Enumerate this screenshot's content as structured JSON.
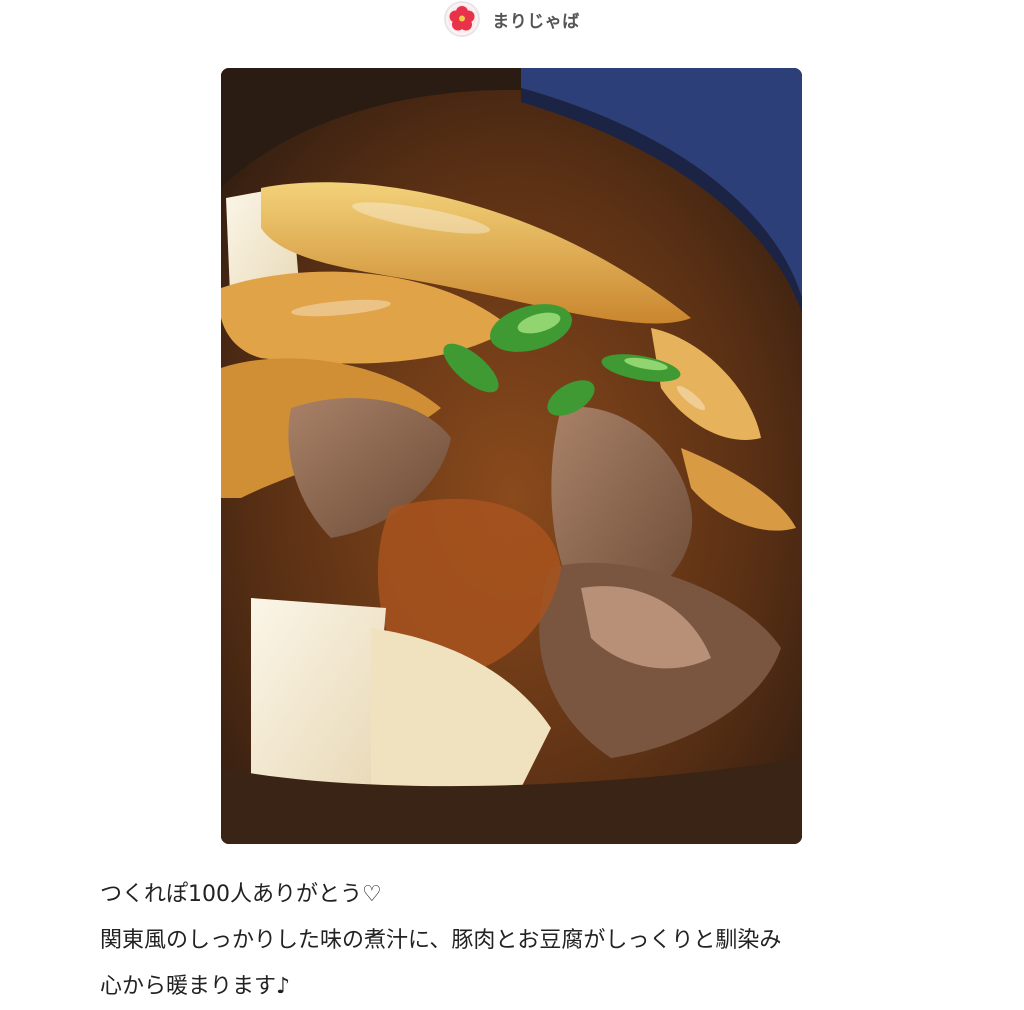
{
  "author": {
    "name": "まりじゃば",
    "avatar_icon": "red-flower-icon"
  },
  "recipe_photo": {
    "icon": "sukiyaki-tofu-photo"
  },
  "description": {
    "lines": [
      "つくれぽ100人ありがとう♡",
      "関東風のしっかりした味の煮汁に、豚肉とお豆腐がしっくりと馴染み",
      "心から暖まります♪"
    ]
  },
  "colors": {
    "text": "#222222",
    "author_text": "#555555",
    "avatar_flower": "#e8324a"
  }
}
